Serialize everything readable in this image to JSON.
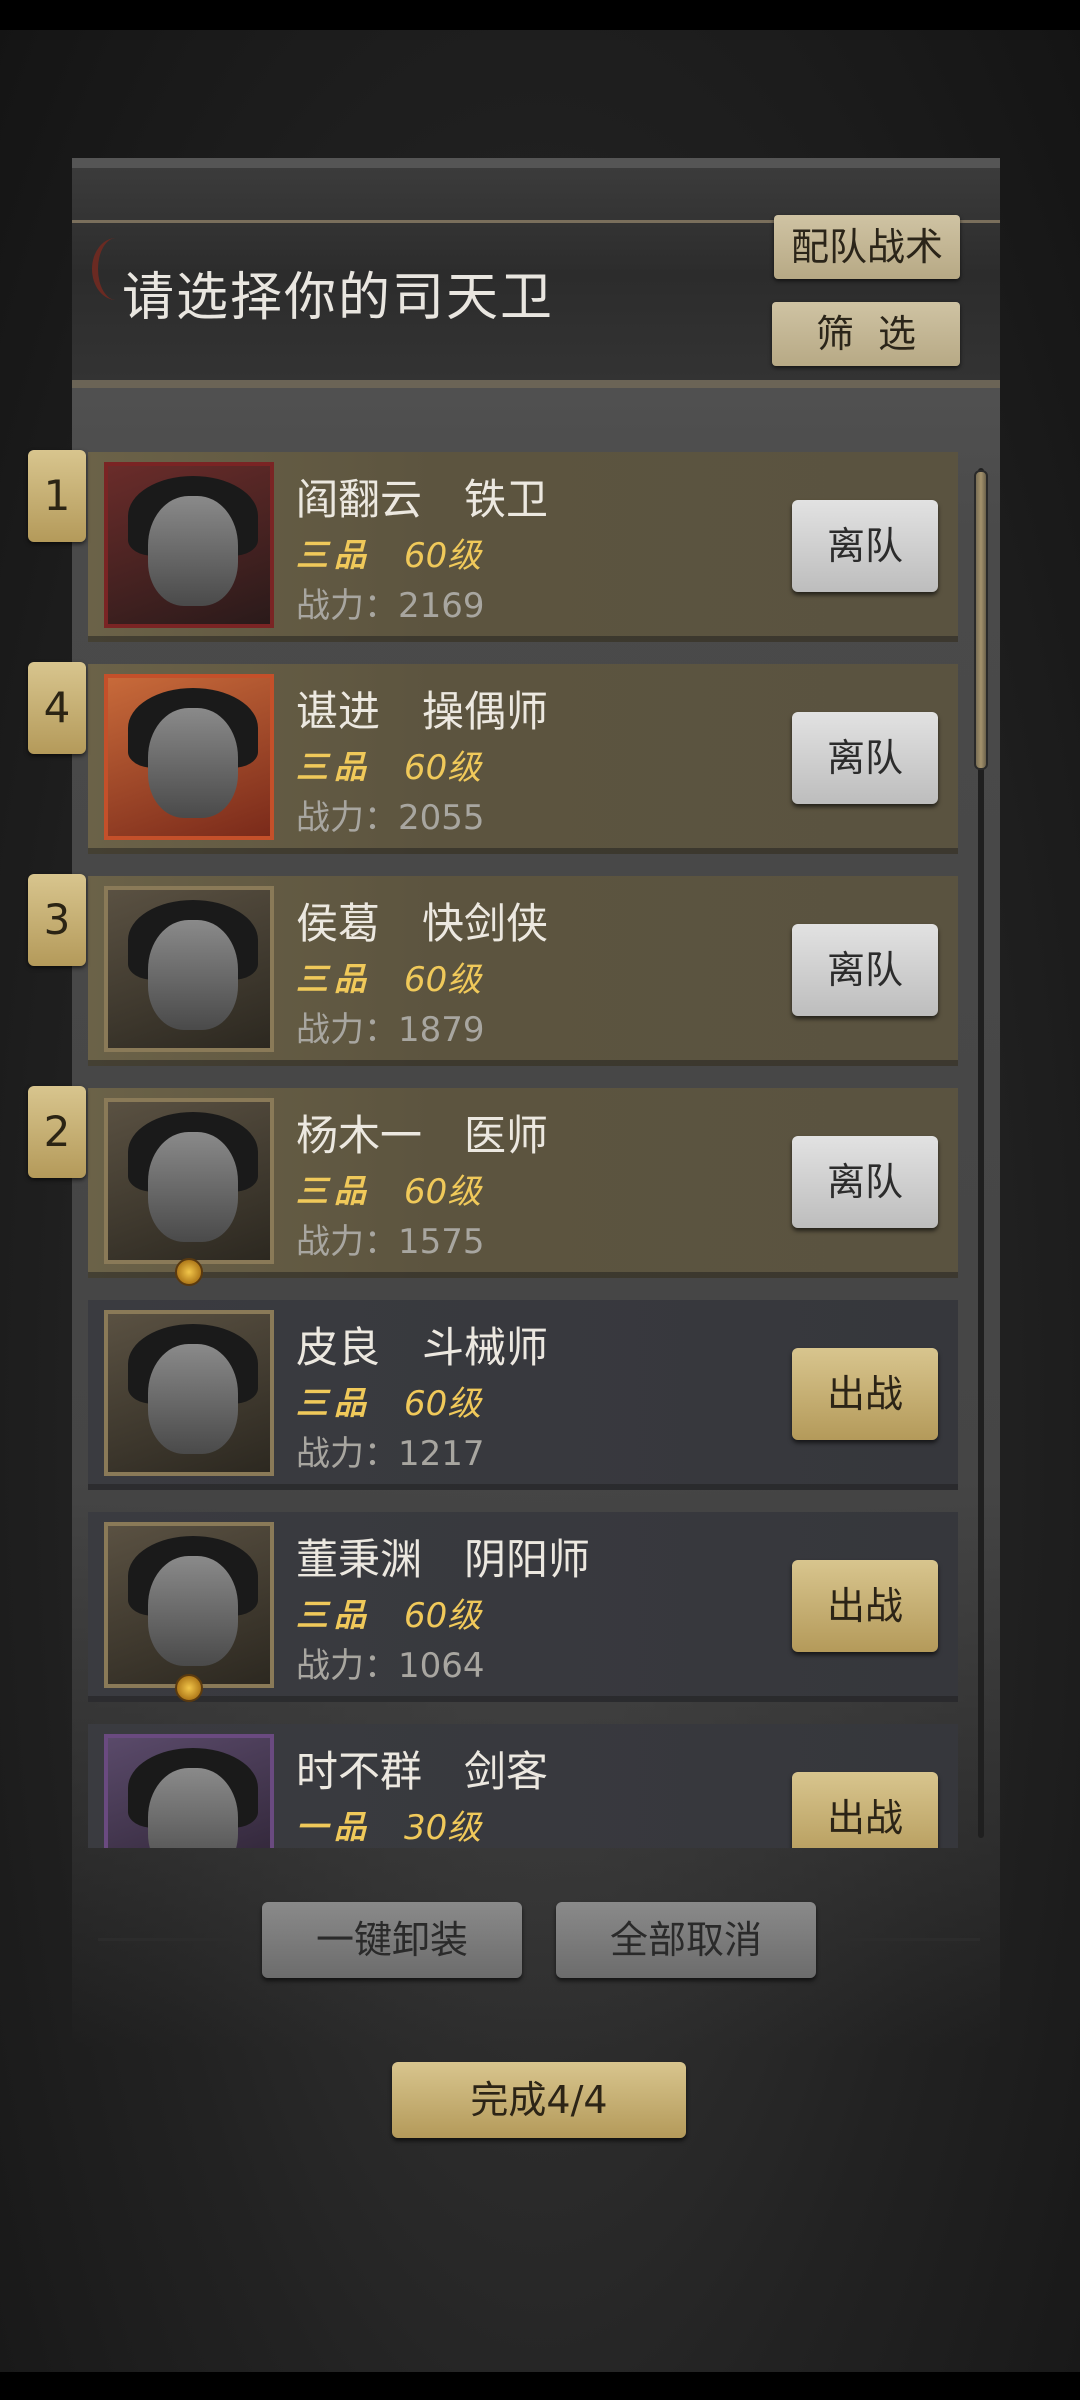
{
  "header": {
    "title": "请选择你的司天卫",
    "tactic_button": "配队战术",
    "filter_button": "筛选"
  },
  "heroes": [
    {
      "order": "1",
      "name": "阎翻云",
      "class": "铁卫",
      "rank": "三品",
      "level": "60级",
      "power": "战力：2169",
      "action": "离队",
      "state": "active",
      "portrait": "red"
    },
    {
      "order": "4",
      "name": "谌进",
      "class": "操偶师",
      "rank": "三品",
      "level": "60级",
      "power": "战力：2055",
      "action": "离队",
      "state": "active",
      "portrait": "orange"
    },
    {
      "order": "3",
      "name": "侯葛",
      "class": "快剑侠",
      "rank": "三品",
      "level": "60级",
      "power": "战力：1879",
      "action": "离队",
      "state": "active",
      "portrait": "plain"
    },
    {
      "order": "2",
      "name": "杨木一",
      "class": "医师",
      "rank": "三品",
      "level": "60级",
      "power": "战力：1575",
      "action": "离队",
      "state": "active",
      "portrait": "plain"
    },
    {
      "order": "",
      "name": "皮良",
      "class": "斗械师",
      "rank": "三品",
      "level": "60级",
      "power": "战力：1217",
      "action": "出战",
      "state": "idle",
      "portrait": "plain"
    },
    {
      "order": "",
      "name": "董秉渊",
      "class": "阴阳师",
      "rank": "三品",
      "level": "60级",
      "power": "战力：1064",
      "action": "出战",
      "state": "idle",
      "portrait": "plain"
    },
    {
      "order": "",
      "name": "时不群",
      "class": "剑客",
      "rank": "一品",
      "level": "30级",
      "power": "",
      "action": "出战",
      "state": "idle",
      "portrait": "purple"
    }
  ],
  "footer": {
    "unequip_all": "一键卸装",
    "cancel_all": "全部取消",
    "done": "完成4/4"
  },
  "colors": {
    "accent_gold": "#d8c58e",
    "rank_text": "#f0c95a",
    "active_card": "#5c543f",
    "idle_card": "#36373c"
  }
}
